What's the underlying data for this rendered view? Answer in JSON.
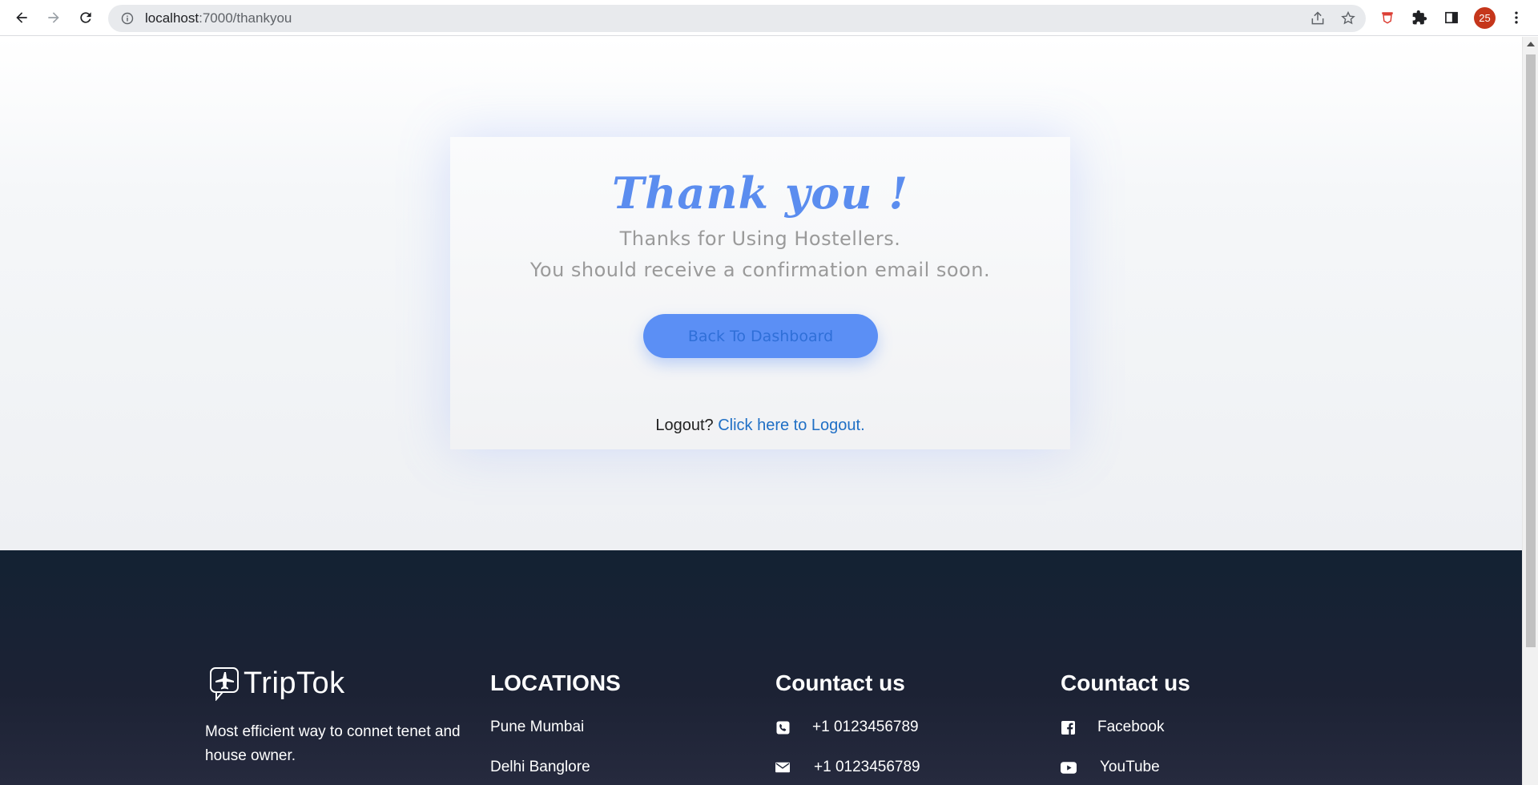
{
  "browser": {
    "url_host": "localhost",
    "url_path": ":7000/thankyou",
    "profile_badge": "25"
  },
  "card": {
    "title": "Thank you !",
    "line1": "Thanks for Using Hostellers.",
    "line2": "You should receive a confirmation email soon.",
    "button_label": "Back To Dashboard",
    "logout_prompt": "Logout?",
    "logout_link": "Click here to Logout."
  },
  "footer": {
    "brand_name": "TripTok",
    "brand_desc": "Most efficient way to connet tenet and house owner.",
    "locations": {
      "heading": "LOCATIONS",
      "items": [
        "Pune Mumbai",
        "Delhi Banglore"
      ]
    },
    "contact_phone": {
      "heading": "Countact us",
      "items": [
        {
          "icon": "phone-icon",
          "label": "+1 0123456789"
        },
        {
          "icon": "envelope-icon",
          "label": "+1 0123456789"
        }
      ]
    },
    "contact_social": {
      "heading": "Countact us",
      "items": [
        {
          "icon": "facebook-icon",
          "label": "Facebook"
        },
        {
          "icon": "youtube-icon",
          "label": "YouTube"
        }
      ]
    }
  },
  "colors": {
    "accent": "#5b8def",
    "button": "#5b8ff5",
    "link": "#1f6fc5",
    "footer_bg": "#132233"
  }
}
